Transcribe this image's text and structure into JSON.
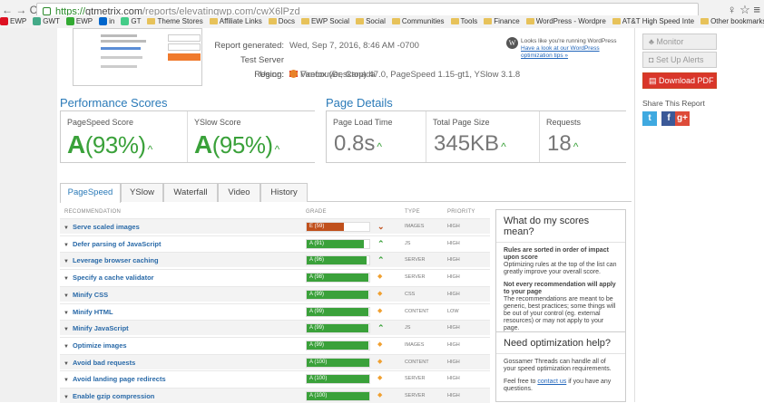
{
  "browser": {
    "url_secure": "https://",
    "url_domain": "gtmetrix.com",
    "url_path": "/reports/elevatingwp.com/cwX6lPzd",
    "bookmarks": [
      "EWP",
      "GWT",
      "EWP",
      "in",
      "GT",
      "Theme Stores",
      "Affiliate Links",
      "Docs",
      "EWP Social",
      "Social",
      "Communities",
      "Tools",
      "Finance",
      "WordPress - Wordpre",
      "AT&T High Speed Inte",
      "Other bookmarks"
    ]
  },
  "report": {
    "generated_label": "Report generated:",
    "generated_value": "Wed, Sep 7, 2016, 8:46 AM -0700",
    "region_label": "Test Server Region:",
    "region_value": "Vancouver, Canada",
    "using_label": "Using:",
    "using_value": "Firefox (Desktop) 47.0, PageSpeed 1.15-gt1, YSlow 3.1.8",
    "wp_note": "Looks like you're running WordPress",
    "wp_link": "Have a look at our WordPress optimization tips »"
  },
  "performance": {
    "title": "Performance Scores",
    "pagespeed_label": "PageSpeed Score",
    "pagespeed_grade": "A",
    "pagespeed_pct": "(93%)",
    "yslow_label": "YSlow Score",
    "yslow_grade": "A",
    "yslow_pct": "(95%)",
    "up_glyph": "^"
  },
  "details": {
    "title": "Page Details",
    "load_label": "Page Load Time",
    "load_value": "0.8s",
    "size_label": "Total Page Size",
    "size_value": "345KB",
    "req_label": "Requests",
    "req_value": "18"
  },
  "tabs": [
    "PageSpeed",
    "YSlow",
    "Waterfall",
    "Video",
    "History"
  ],
  "table": {
    "headers": {
      "rec": "RECOMMENDATION",
      "grade": "GRADE",
      "type": "TYPE",
      "priority": "PRIORITY"
    },
    "rows": [
      {
        "name": "Serve scaled images",
        "grade": "E (59)",
        "score": 59,
        "color": "#c0501c",
        "arrow": "down",
        "type": "IMAGES",
        "priority": "HIGH"
      },
      {
        "name": "Defer parsing of JavaScript",
        "grade": "A (91)",
        "score": 91,
        "color": "#3aa13a",
        "arrow": "up",
        "type": "JS",
        "priority": "HIGH"
      },
      {
        "name": "Leverage browser caching",
        "grade": "A (96)",
        "score": 96,
        "color": "#3aa13a",
        "arrow": "up",
        "type": "SERVER",
        "priority": "HIGH"
      },
      {
        "name": "Specify a cache validator",
        "grade": "A (98)",
        "score": 98,
        "color": "#3aa13a",
        "arrow": "diamond",
        "type": "SERVER",
        "priority": "HIGH"
      },
      {
        "name": "Minify CSS",
        "grade": "A (99)",
        "score": 99,
        "color": "#3aa13a",
        "arrow": "diamond",
        "type": "CSS",
        "priority": "HIGH"
      },
      {
        "name": "Minify HTML",
        "grade": "A (99)",
        "score": 99,
        "color": "#3aa13a",
        "arrow": "diamond",
        "type": "CONTENT",
        "priority": "LOW"
      },
      {
        "name": "Minify JavaScript",
        "grade": "A (99)",
        "score": 99,
        "color": "#3aa13a",
        "arrow": "up",
        "type": "JS",
        "priority": "HIGH"
      },
      {
        "name": "Optimize images",
        "grade": "A (99)",
        "score": 99,
        "color": "#3aa13a",
        "arrow": "diamond",
        "type": "IMAGES",
        "priority": "HIGH"
      },
      {
        "name": "Avoid bad requests",
        "grade": "A (100)",
        "score": 100,
        "color": "#3aa13a",
        "arrow": "diamond",
        "type": "CONTENT",
        "priority": "HIGH"
      },
      {
        "name": "Avoid landing page redirects",
        "grade": "A (100)",
        "score": 100,
        "color": "#3aa13a",
        "arrow": "diamond",
        "type": "SERVER",
        "priority": "HIGH"
      },
      {
        "name": "Enable gzip compression",
        "grade": "A (100)",
        "score": 100,
        "color": "#3aa13a",
        "arrow": "diamond",
        "type": "SERVER",
        "priority": "HIGH"
      }
    ]
  },
  "info1": {
    "title": "What do my scores mean?",
    "b1": "Rules are sorted in order of impact upon score",
    "t1": "Optimizing rules at the top of the list can greatly improve your overall score.",
    "b2": "Not every recommendation will apply to your page",
    "t2": "The recommendations are meant to be generic, best practices; some things will be out of your control (eg. external resources) or may not apply to your page."
  },
  "info2": {
    "title": "Need optimization help?",
    "t1": "Gossamer Threads can handle all of your speed optimization requirements.",
    "t2a": "Feel free to ",
    "t2link": "contact us",
    "t2b": " if you have any questions."
  },
  "sidebar": {
    "monitor": "Monitor",
    "alerts": "Set Up Alerts",
    "pdf": "Download PDF",
    "share": "Share This Report",
    "share_icons": [
      "t",
      "f",
      "g+"
    ]
  },
  "colors": {
    "accent": "#2a7ab8",
    "good": "#3aa13a",
    "bad": "#c0501c",
    "warn": "#f0a030",
    "pdf": "#d9362a"
  }
}
